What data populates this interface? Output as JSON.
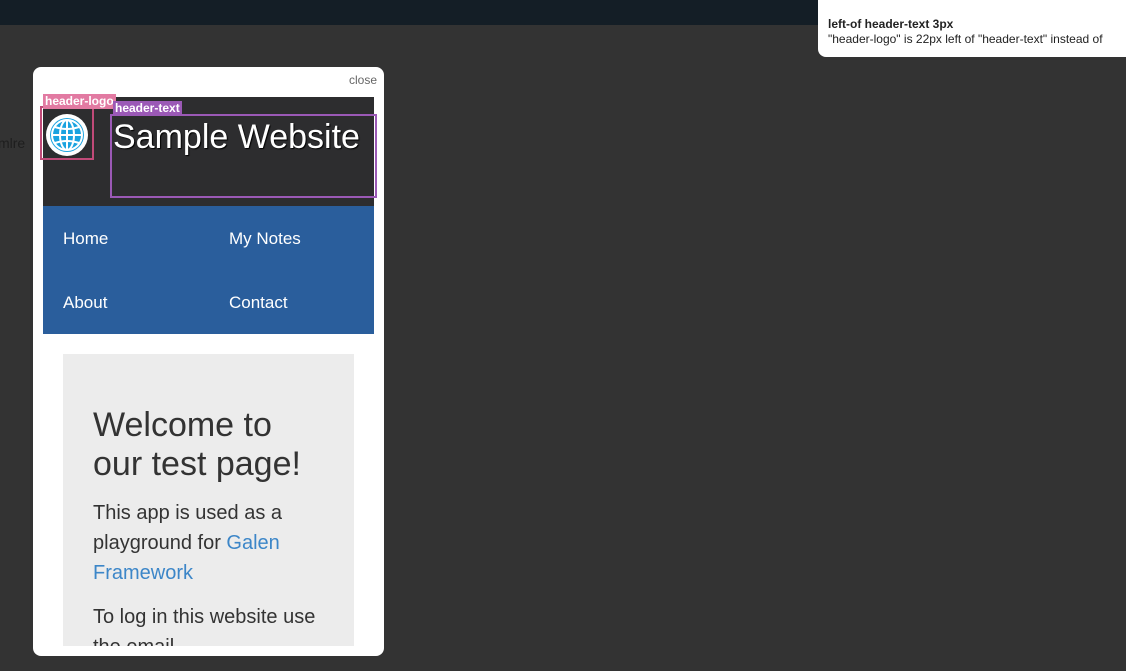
{
  "background_fragment": "mlre",
  "notification": {
    "title": "left-of header-text 3px",
    "message": "\"header-logo\" is 22px left of \"header-text\" instead of"
  },
  "dialog": {
    "close_label": "close"
  },
  "site": {
    "title": "Sample Website",
    "nav": [
      "Home",
      "My Notes",
      "About",
      "Contact"
    ],
    "welcome_heading": "Welcome to our test page!",
    "intro_text": "This app is used as a playground for ",
    "intro_link": "Galen Framework",
    "login_text": "To log in this website use the email"
  },
  "overlays": [
    {
      "label": "header-logo",
      "color": "#e27aa2"
    },
    {
      "label": "header-text",
      "color": "#9b59b6"
    }
  ],
  "colors": {
    "page_bg": "#333333",
    "header_bg": "#2d2d2f",
    "nav_bg": "#2a5e9c",
    "content_bg": "#ececec",
    "link": "#3c86c8",
    "logo_blue": "#1aa3e0"
  }
}
